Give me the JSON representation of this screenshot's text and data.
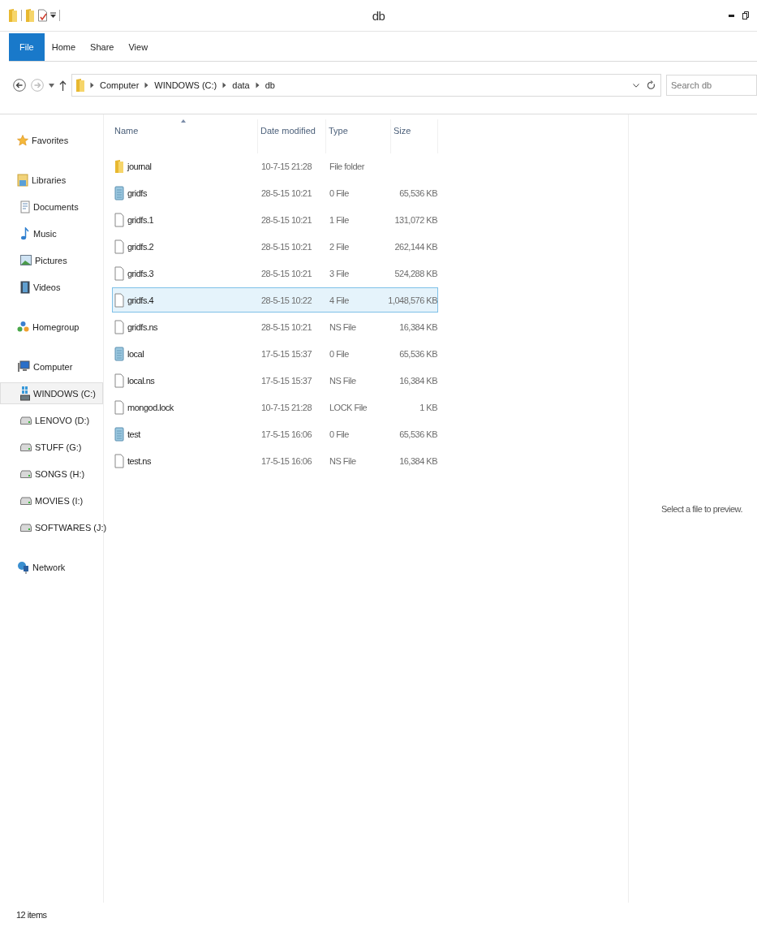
{
  "window": {
    "title": "db"
  },
  "ribbon": {
    "file_button": "File",
    "tabs": [
      "Home",
      "Share",
      "View"
    ]
  },
  "address_bar": {
    "path": [
      "Computer",
      "WINDOWS (C:)",
      "data",
      "db"
    ]
  },
  "search": {
    "placeholder": "Search db"
  },
  "sidebar": {
    "groups": [
      {
        "label": "Favorites",
        "kind": "favorites",
        "selected": false
      },
      {
        "label": "Libraries",
        "kind": "libraries",
        "selected": false,
        "children": [
          {
            "label": "Documents",
            "kind": "documents",
            "selected": false
          },
          {
            "label": "Music",
            "kind": "music",
            "selected": false
          },
          {
            "label": "Pictures",
            "kind": "pictures",
            "selected": false
          },
          {
            "label": "Videos",
            "kind": "videos",
            "selected": false
          }
        ]
      },
      {
        "label": "Homegroup",
        "kind": "homegroup",
        "selected": false
      },
      {
        "label": "Computer",
        "kind": "computer",
        "selected": false,
        "children": [
          {
            "label": "WINDOWS (C:)",
            "kind": "system-drive",
            "selected": true
          },
          {
            "label": "LENOVO (D:)",
            "kind": "drive",
            "selected": false
          },
          {
            "label": "STUFF (G:)",
            "kind": "drive",
            "selected": false
          },
          {
            "label": "SONGS (H:)",
            "kind": "drive",
            "selected": false
          },
          {
            "label": "MOVIES (I:)",
            "kind": "drive",
            "selected": false
          },
          {
            "label": "SOFTWARES (J:)",
            "kind": "drive",
            "selected": false
          }
        ]
      },
      {
        "label": "Network",
        "kind": "network",
        "selected": false
      }
    ]
  },
  "table": {
    "columns": [
      "Name",
      "Date modified",
      "Type",
      "Size"
    ],
    "rows": [
      {
        "name": "journal",
        "date": "10-7-15 21:28",
        "type": "File folder",
        "kind": "folder",
        "selected": false
      },
      {
        "name": "gridfs",
        "date": "28-5-15 10:21",
        "type": "0 File",
        "size": "65,536 KB",
        "kind": "data",
        "selected": false
      },
      {
        "name": "gridfs.1",
        "date": "28-5-15 10:21",
        "type": "1 File",
        "size": "131,072 KB",
        "kind": "file",
        "selected": false
      },
      {
        "name": "gridfs.2",
        "date": "28-5-15 10:21",
        "type": "2 File",
        "size": "262,144 KB",
        "kind": "file",
        "selected": false
      },
      {
        "name": "gridfs.3",
        "date": "28-5-15 10:21",
        "type": "3 File",
        "size": "524,288 KB",
        "kind": "file",
        "selected": false
      },
      {
        "name": "gridfs.4",
        "date": "28-5-15 10:22",
        "type": "4 File",
        "size": "1,048,576 KB",
        "kind": "file",
        "selected": true
      },
      {
        "name": "gridfs.ns",
        "date": "28-5-15 10:21",
        "type": "NS File",
        "size": "16,384 KB",
        "kind": "file",
        "selected": false
      },
      {
        "name": "local",
        "date": "17-5-15 15:37",
        "type": "0 File",
        "size": "65,536 KB",
        "kind": "data",
        "selected": false
      },
      {
        "name": "local.ns",
        "date": "17-5-15 15:37",
        "type": "NS File",
        "size": "16,384 KB",
        "kind": "file",
        "selected": false
      },
      {
        "name": "mongod.lock",
        "date": "10-7-15 21:28",
        "type": "LOCK File",
        "size": "1 KB",
        "kind": "file",
        "selected": false
      },
      {
        "name": "test",
        "date": "17-5-15 16:06",
        "type": "0 File",
        "size": "65,536 KB",
        "kind": "data",
        "selected": false
      },
      {
        "name": "test.ns",
        "date": "17-5-15 16:06",
        "type": "NS File",
        "size": "16,384 KB",
        "kind": "file",
        "selected": false
      }
    ]
  },
  "preview": {
    "message": "Select a file to preview."
  },
  "status_bar": {
    "item_count": "12 items"
  }
}
